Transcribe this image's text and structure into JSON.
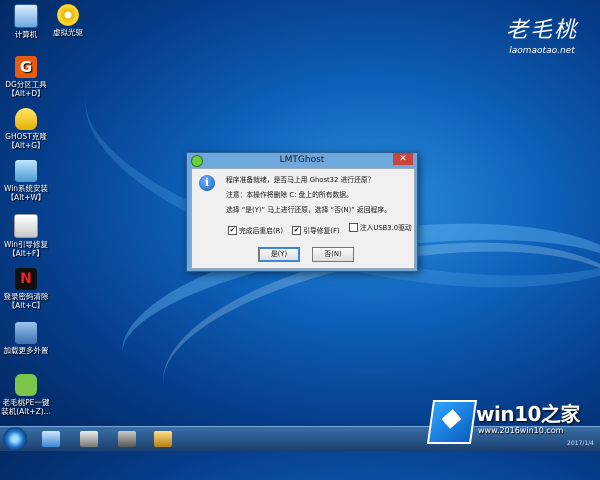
{
  "desktop": {
    "icons": [
      {
        "label": "计算机",
        "icon": "computer-icon"
      },
      {
        "label": "虚拟光驱",
        "icon": "disc-icon"
      },
      {
        "label": "DG分区工具",
        "hotkey": "【Alt+D】",
        "icon": "dg-partition-icon"
      },
      {
        "label": "GHOST克隆",
        "hotkey": "【Alt+G】",
        "icon": "ghost-icon"
      },
      {
        "label": "Win系统安装",
        "hotkey": "【Alt+W】",
        "icon": "win-setup-icon"
      },
      {
        "label": "Win引导修复",
        "hotkey": "【Alt+F】",
        "icon": "boot-repair-icon"
      },
      {
        "label": "登录密码清除",
        "hotkey": "【Alt+C】",
        "icon": "password-clear-icon"
      },
      {
        "label": "加载更多外置",
        "icon": "load-more-icon"
      },
      {
        "label": "老毛桃PE一键",
        "hotkey": "装机(Alt+Z)...",
        "icon": "pe-install-icon"
      }
    ]
  },
  "brand": {
    "name": "老毛桃",
    "url": "laomaotao.net"
  },
  "dialog": {
    "title": "LMTGhost",
    "close": "✕",
    "line1": "程序准备就绪，是否马上用 Ghost32 进行还原？",
    "line2": "注意：本操作将删除 C: 盘上的所有数据。",
    "line3": "选择 “是(Y)” 马上进行还原，选择 “否(N)” 返回程序。",
    "options": [
      {
        "label": "完成后重启(R)",
        "checked": true
      },
      {
        "label": "引导修复(F)",
        "checked": true
      },
      {
        "label": "注入USB3.0驱动",
        "checked": false
      }
    ],
    "yes": "是(Y)",
    "no": "否(N)"
  },
  "watermark": {
    "title": "win10之家",
    "url": "www.2016win10.com"
  },
  "taskbar": {
    "clock": "2017/1/4"
  }
}
